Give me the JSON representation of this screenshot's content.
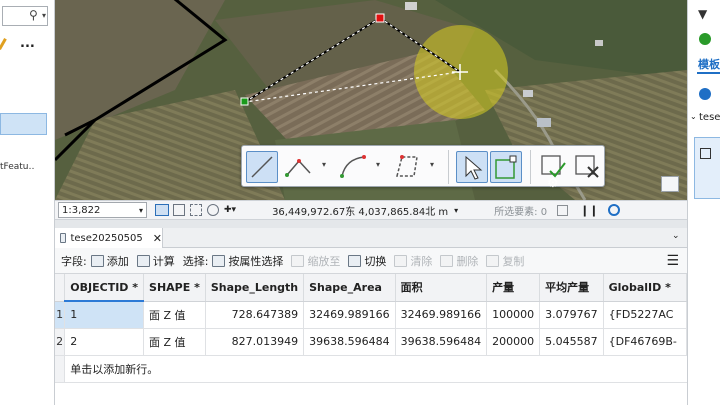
{
  "left_panel": {
    "search_icon": "search-icon",
    "more_label": "...",
    "clipped_text": "tFeatu‥"
  },
  "map_toolbar": {
    "tools": [
      "line-tool",
      "polyline-tool",
      "arc-tool",
      "polygon-tool",
      "select-tool",
      "edit-vertices-tool",
      "finish-sketch-tool",
      "cancel-sketch-tool"
    ]
  },
  "status_bar": {
    "scale": "1:3,822",
    "coordinates": "36,449,972.67东 4,037,865.84北 m",
    "selected_label": "所选要素: 0"
  },
  "attribute_table": {
    "tab_label": "tese20250505",
    "toolbar": {
      "fields_label": "字段:",
      "add_label": "添加",
      "calculate_label": "计算",
      "selection_label": "选择:",
      "select_by_attr_label": "按属性选择",
      "zoom_to_label": "缩放至",
      "switch_label": "切换",
      "clear_label": "清除",
      "delete_label": "删除",
      "copy_label": "复制"
    },
    "columns": [
      "OBJECTID *",
      "SHAPE *",
      "Shape_Length",
      "Shape_Area",
      "面积",
      "产量",
      "平均产量",
      "GlobalID *"
    ],
    "rows": [
      {
        "n": "1",
        "objectid": "1",
        "shape": "面 Z 值",
        "length": "728.647389",
        "area": "32469.989166",
        "mj": "32469.989166",
        "cl": "100000",
        "pj": "3.079767",
        "gid": "{FD5227AC"
      },
      {
        "n": "2",
        "objectid": "2",
        "shape": "面 Z 值",
        "length": "827.013949",
        "area": "39638.596484",
        "mj": "39638.596484",
        "cl": "200000",
        "pj": "5.045587",
        "gid": "{DF46769B-"
      }
    ],
    "add_row_label": "单击以添加新行。"
  },
  "right_panel": {
    "title_fragment": "模板",
    "item_label": "tese",
    "accent": "#1f6fc5"
  }
}
